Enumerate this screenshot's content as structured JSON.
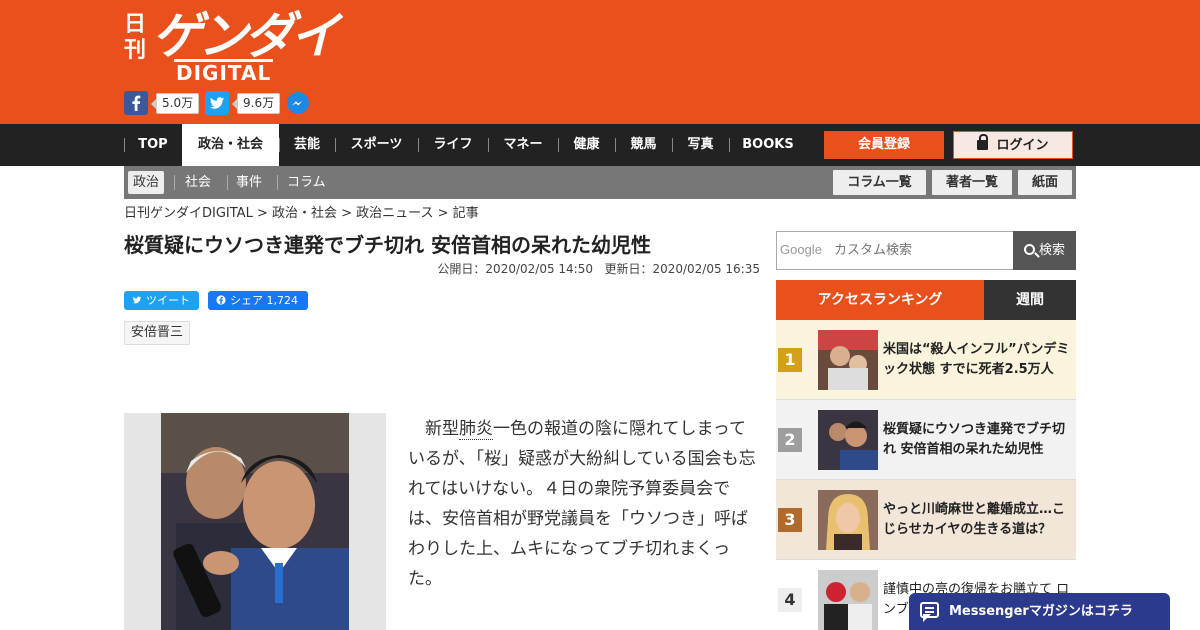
{
  "header": {
    "logo_nikkan": "日刊",
    "logo_main": "ゲンダイ",
    "logo_sub": "DIGITAL",
    "facebook_count": "5.0万",
    "twitter_count": "9.6万"
  },
  "nav": {
    "items": [
      "TOP",
      "政治・社会",
      "芸能",
      "スポーツ",
      "ライフ",
      "マネー",
      "健康",
      "競馬",
      "写真",
      "BOOKS"
    ],
    "active": "政治・社会",
    "register_label": "会員登録",
    "login_label": "ログイン"
  },
  "subnav": {
    "items": [
      "政治",
      "社会",
      "事件",
      "コラム"
    ],
    "active": "政治",
    "buttons": [
      "コラム一覧",
      "著者一覧",
      "紙面"
    ]
  },
  "breadcrumb": "日刊ゲンダイDIGITAL > 政治・社会 > 政治ニュース > 記事",
  "article": {
    "title": "桜質疑にウソつき連発でブチ切れ 安倍首相の呆れた幼児性",
    "published": "公開日：2020/02/05 14:50",
    "updated": "更新日：2020/02/05 16:35",
    "tweet_label": "ツイート",
    "share_label": "シェア 1,724",
    "tag": "安倍晋三",
    "body_lead": "新型",
    "body_keyword": "肺炎",
    "body_rest": "一色の報道の陰に隠れてしまっているが、「桜」疑惑が大紛糾している国会も忘れてはいけない。４日の衆院予算委員会では、安倍首相が野党議員を「ウソつき」呼ばわりした上、ムキになってブチ切れまくった。"
  },
  "search": {
    "google_label": "Google",
    "placeholder": "カスタム検索",
    "button_label": "検索"
  },
  "ranking": {
    "tab_access": "アクセスランキング",
    "tab_weekly": "週間",
    "items": [
      {
        "rank": "1",
        "title": "米国は“殺人インフル”パンデミック状態 すでに死者2.5万人",
        "color": "#d4a017"
      },
      {
        "rank": "2",
        "title": "桜質疑にウソつき連発でブチ切れ 安倍首相の呆れた幼児性",
        "color": "#9e9e9e"
      },
      {
        "rank": "3",
        "title": "やっと川崎麻世と離婚成立…こじらせカイヤの生きる道は？",
        "color": "#b06a2c"
      },
      {
        "rank": "4",
        "title": "謹慎中の亮の復帰をお膳立て ロンブー",
        "color": "#eee"
      }
    ]
  },
  "messenger": {
    "label": "Messengerマガジンはコチラ"
  },
  "colors": {
    "brand": "#e9501c",
    "nav_bg": "#222222",
    "subnav_bg": "#777777",
    "messenger": "#2b3a8c"
  }
}
